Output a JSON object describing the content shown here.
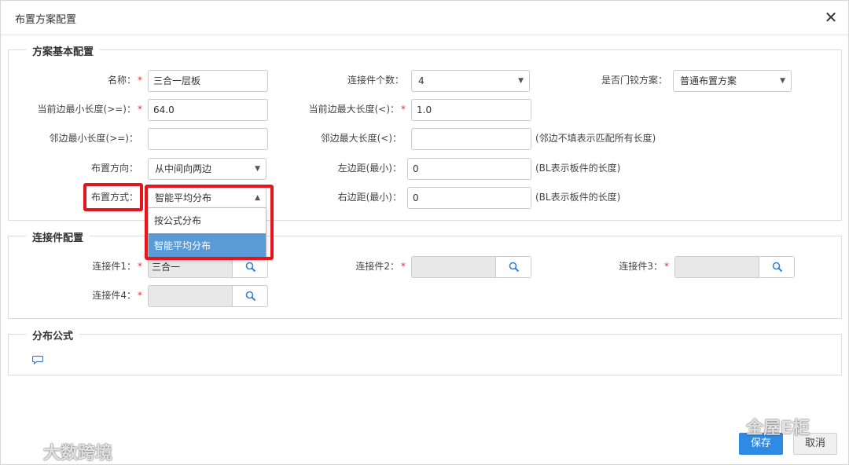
{
  "dialog": {
    "title": "布置方案配置",
    "close_glyph": "✕"
  },
  "sections": {
    "basic": "方案基本配置",
    "connectors": "连接件配置",
    "formula": "分布公式"
  },
  "basic": {
    "name": {
      "label": "名称：",
      "value": "三合一层板"
    },
    "connector_count": {
      "label": "连接件个数：",
      "value": "4"
    },
    "door_hinge": {
      "label": "是否门铰方案：",
      "value": "普通布置方案"
    },
    "cur_min": {
      "label": "当前边最小长度(>=)：",
      "value": "64.0"
    },
    "cur_max": {
      "label": "当前边最大长度(<)：",
      "value": "1.0"
    },
    "adj_min": {
      "label": "邻边最小长度(>=)：",
      "value": ""
    },
    "adj_max": {
      "label": "邻边最大长度(<)：",
      "value": "",
      "hint": "(邻边不填表示匹配所有长度)"
    },
    "direction": {
      "label": "布置方向：",
      "value": "从中间向两边"
    },
    "left_margin": {
      "label": "左边距(最小)：",
      "value": "0",
      "hint": "(BL表示板件的长度)"
    },
    "method": {
      "label": "布置方式：",
      "value": "智能平均分布"
    },
    "right_margin": {
      "label": "右边距(最小)：",
      "value": "0",
      "hint": "(BL表示板件的长度)"
    }
  },
  "method_dropdown": {
    "options": [
      "按公式分布",
      "智能平均分布"
    ],
    "selected": "智能平均分布"
  },
  "connectors": {
    "c1": {
      "label": "连接件1：",
      "value": "三合一"
    },
    "c2": {
      "label": "连接件2：",
      "value": ""
    },
    "c3": {
      "label": "连接件3：",
      "value": ""
    },
    "c4": {
      "label": "连接件4：",
      "value": ""
    }
  },
  "required_mark": "*",
  "footer": {
    "save": "保存",
    "cancel": "取消"
  },
  "watermarks": {
    "left": "大数跨境",
    "right": "全屋E柜"
  },
  "colors": {
    "primary": "#2f8ae4",
    "selected_option": "#5b9bd5",
    "highlight": "#e8141b",
    "required": "#e53030"
  },
  "icons": {
    "search": "search-icon",
    "comment": "comment-icon",
    "close": "close-icon",
    "caret": "caret-down-icon"
  }
}
